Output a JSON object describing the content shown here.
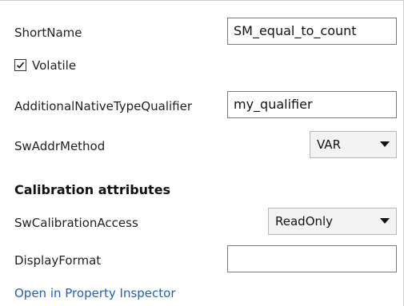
{
  "form": {
    "short_name": {
      "label": "ShortName",
      "value": "SM_equal_to_count"
    },
    "volatile": {
      "label": "Volatile",
      "checked": true
    },
    "additional_native_type_qualifier": {
      "label": "AdditionalNativeTypeQualifier",
      "value": "my_qualifier"
    },
    "sw_addr_method": {
      "label": "SwAddrMethod",
      "selected": "VAR"
    },
    "calibration_section": {
      "title": "Calibration attributes"
    },
    "sw_calibration_access": {
      "label": "SwCalibrationAccess",
      "selected": "ReadOnly"
    },
    "display_format": {
      "label": "DisplayFormat",
      "value": ""
    },
    "inspector_link": {
      "label": "Open in Property Inspector"
    }
  },
  "colors": {
    "link": "#1f5fbf",
    "border": "#7a7a7a",
    "select_background": "#f3f3f3"
  },
  "icons": {
    "checkbox": "check-icon",
    "dropdown": "chevron-down-icon"
  }
}
